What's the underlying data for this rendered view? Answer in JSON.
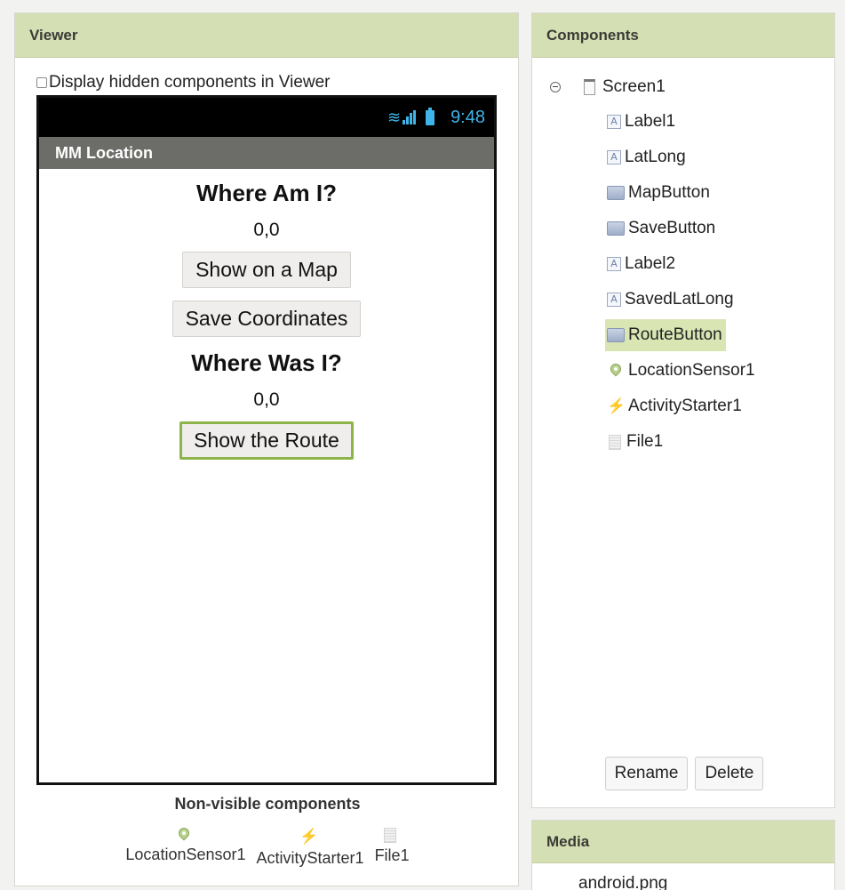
{
  "viewer": {
    "title": "Viewer",
    "hidden_toggle_label": "Display hidden components in Viewer",
    "phone": {
      "time": "9:48",
      "app_title": "MM Location",
      "heading1": "Where Am I?",
      "coords1": "0,0",
      "btn_map": "Show on a Map",
      "btn_save": "Save Coordinates",
      "heading2": "Where Was I?",
      "coords2": "0,0",
      "btn_route": "Show the Route"
    },
    "nonvisible": {
      "title": "Non-visible components",
      "items": [
        {
          "label": "LocationSensor1",
          "icon": "location-pin-icon"
        },
        {
          "label": "ActivityStarter1",
          "icon": "lightning-icon"
        },
        {
          "label": "File1",
          "icon": "file-icon"
        }
      ]
    }
  },
  "components": {
    "title": "Components",
    "root": "Screen1",
    "items": [
      {
        "label": "Label1",
        "icon": "label-icon"
      },
      {
        "label": "LatLong",
        "icon": "label-icon"
      },
      {
        "label": "MapButton",
        "icon": "button-icon"
      },
      {
        "label": "SaveButton",
        "icon": "button-icon"
      },
      {
        "label": "Label2",
        "icon": "label-icon"
      },
      {
        "label": "SavedLatLong",
        "icon": "label-icon"
      },
      {
        "label": "RouteButton",
        "icon": "button-icon",
        "selected": true
      },
      {
        "label": "LocationSensor1",
        "icon": "location-pin-icon"
      },
      {
        "label": "ActivityStarter1",
        "icon": "lightning-icon"
      },
      {
        "label": "File1",
        "icon": "file-icon"
      }
    ],
    "rename_label": "Rename",
    "delete_label": "Delete"
  },
  "media": {
    "title": "Media",
    "items": [
      "android.png"
    ]
  },
  "colors": {
    "panel_header": "#d5dfb4",
    "selected": "#d9e6b4",
    "selected_border": "#8cb449",
    "status_accent": "#3fb4e8",
    "titlebar": "#6c6c69"
  }
}
